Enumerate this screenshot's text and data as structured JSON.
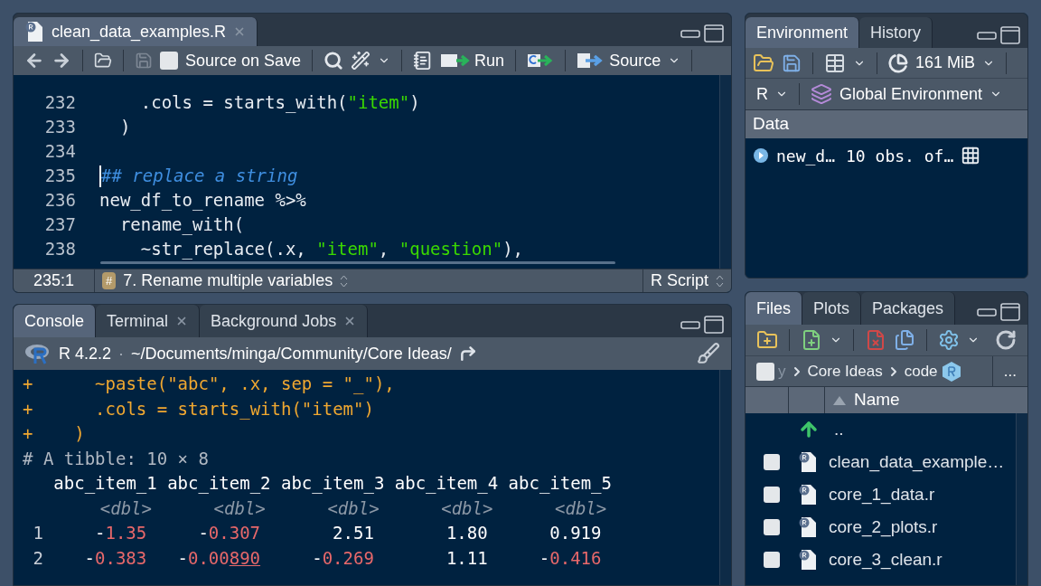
{
  "editor": {
    "tabs": [
      {
        "label": "clean_data_examples.R",
        "selected": true,
        "closable": true
      }
    ],
    "toolbar": {
      "source_on_save": {
        "label": "Source on Save",
        "checked": false
      },
      "run_label": "Run",
      "source_label": "Source"
    },
    "lines": [
      {
        "number": "232",
        "caret": false,
        "segments": [
          {
            "kind": "plain",
            "text": "    .cols = starts_with("
          },
          {
            "kind": "string",
            "text": "\"item\""
          },
          {
            "kind": "plain",
            "text": ")"
          }
        ]
      },
      {
        "number": "233",
        "caret": false,
        "segments": [
          {
            "kind": "plain",
            "text": "  )"
          }
        ]
      },
      {
        "number": "234",
        "caret": false
      },
      {
        "number": "235",
        "caret": true,
        "segments": [
          {
            "kind": "comment",
            "text": "## replace a string"
          }
        ]
      },
      {
        "number": "236",
        "caret": false,
        "segments": [
          {
            "kind": "plain",
            "text": "new_df_to_rename %>%"
          }
        ]
      },
      {
        "number": "237",
        "caret": false,
        "segments": [
          {
            "kind": "plain",
            "text": "  rename_with("
          }
        ]
      },
      {
        "number": "238",
        "caret": false,
        "segments": [
          {
            "kind": "plain",
            "text": "    ~str_replace(.x, "
          },
          {
            "kind": "string",
            "text": "\"item\""
          },
          {
            "kind": "plain",
            "text": ", "
          },
          {
            "kind": "string",
            "text": "\"question\""
          },
          {
            "kind": "plain",
            "text": "),"
          }
        ]
      }
    ],
    "status": {
      "position": "235:1",
      "section_icon": "#",
      "section": "7. Rename multiple variables",
      "file_type": "R Script"
    }
  },
  "console": {
    "tabs": [
      {
        "label": "Console",
        "selected": true,
        "closable": false
      },
      {
        "label": "Terminal",
        "selected": false,
        "closable": true
      },
      {
        "label": "Background Jobs",
        "selected": false,
        "closable": true
      }
    ],
    "version": "R 4.2.2",
    "separator": "·",
    "path": "~/Documents/minga/Community/Core Ideas/",
    "input_lines": [
      {
        "prompt": "+",
        "code": "    ~paste(\"abc\", .x, sep = \"_\"),"
      },
      {
        "prompt": "+",
        "code": "    .cols = starts_with(\"item\")"
      },
      {
        "prompt": "+",
        "code": "  )"
      }
    ],
    "tibble": {
      "caption": "# A tibble: 10 × 8",
      "columns": [
        {
          "name": "abc_item_1",
          "type": "<dbl>"
        },
        {
          "name": "abc_item_2",
          "type": "<dbl>"
        },
        {
          "name": "abc_item_3",
          "type": "<dbl>"
        },
        {
          "name": "abc_item_4",
          "type": "<dbl>"
        },
        {
          "name": "abc_item_5",
          "type": "<dbl>"
        }
      ],
      "rows": [
        {
          "index": "1",
          "cells": [
            {
              "sign": "-",
              "digits": "1.35"
            },
            {
              "sign": "-",
              "digits": "0.307"
            },
            {
              "digits": "2.51"
            },
            {
              "digits": "1.80"
            },
            {
              "digits": "0.919"
            }
          ]
        },
        {
          "index": "2",
          "cells": [
            {
              "sign": "-",
              "digits": "0.383"
            },
            {
              "sign": "-",
              "digits": "0.00",
              "underlined": "890"
            },
            {
              "sign": "-",
              "digits": "0.269"
            },
            {
              "digits": "1.11"
            },
            {
              "sign": "-",
              "digits": "0.416"
            }
          ]
        }
      ]
    }
  },
  "environment": {
    "tabs": [
      {
        "label": "Environment",
        "selected": true
      },
      {
        "label": "History",
        "selected": false
      }
    ],
    "memory": "161 MiB",
    "language": "R",
    "scope": "Global Environment",
    "section": "Data",
    "objects": [
      {
        "name": "new_d…",
        "value": "10 obs. of…"
      }
    ]
  },
  "files": {
    "tabs": [
      {
        "label": "Files",
        "selected": true
      },
      {
        "label": "Plots",
        "selected": false
      },
      {
        "label": "Packages",
        "selected": false
      }
    ],
    "select_all": {
      "checked": false
    },
    "breadcrumb": [
      {
        "label": "y",
        "faded": true
      },
      {
        "label": "Core Ideas",
        "faded": false
      },
      {
        "label": "code",
        "faded": false
      }
    ],
    "more": "...",
    "column": "Name",
    "parent": "..",
    "items": [
      {
        "name": "clean_data_example…",
        "checked": false
      },
      {
        "name": "core_1_data.r",
        "checked": false
      },
      {
        "name": "core_2_plots.r",
        "checked": false
      },
      {
        "name": "core_3_clean.r",
        "checked": false
      }
    ]
  }
}
